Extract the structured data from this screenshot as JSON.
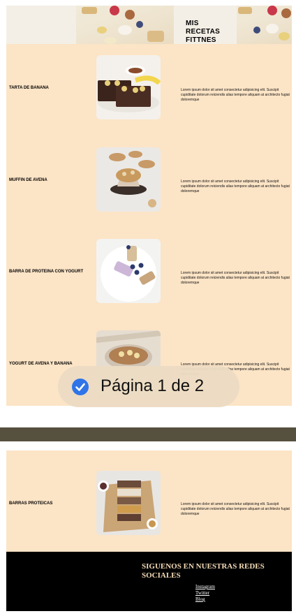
{
  "header": {
    "title_lines": [
      "MIS",
      "RECETAS",
      "FITTNES"
    ]
  },
  "recipes": [
    {
      "name": "TARTA DE BANANA",
      "description": "Lorem ipsum dolor sit amet consectetur adipisicing elit. Suscipit cupiditate dolorum reiciendis alias tempore aliquam at architecto fugiat doloremque",
      "image": "banana-cake-photo"
    },
    {
      "name": "MUFFIN DE AVENA",
      "description": "Lorem ipsum dolor sit amet consectetur adipisicing elit. Suscipit cupiditate dolorum reiciendis alias tempore aliquam at architecto fugiat doloremque",
      "image": "oat-muffin-photo"
    },
    {
      "name": "BARRA DE PROTEINA CON YOGURT",
      "description": "Lorem ipsum dolor sit amet consectetur adipisicing elit. Suscipit cupiditate dolorum reiciendis alias tempore aliquam at architecto fugiat doloremque",
      "image": "yogurt-protein-bar-photo"
    },
    {
      "name": "YOGURT DE AVENA Y BANANA",
      "description": "Lorem ipsum dolor sit amet consectetur adipisicing elit. Suscipit cupiditate dolorum reiciendis alias tempore aliquam at architecto fugiat doloremque",
      "image": "oat-banana-yogurt-photo"
    },
    {
      "name": "BARRAS PROTEICAS",
      "description": "Lorem ipsum dolor sit amet consectetur adipisicing elit. Suscipit cupiditate dolorum reiciendis alias tempore aliquam at architecto fugiat doloremque",
      "image": "protein-bars-photo"
    }
  ],
  "page_indicator": {
    "text": "Página 1 de 2",
    "icon": "checkmark-circle-icon"
  },
  "footer": {
    "title": "SIGUENOS EN NUESTRAS REDES SOCIALES",
    "links": [
      "Instagram",
      "Twitter",
      "Blog"
    ]
  },
  "colors": {
    "page_background": "#fce4c6",
    "footer_background": "#000000",
    "footer_title": "#f5dcb8",
    "accent_blue": "#2f74e8",
    "divider": "#56503f"
  }
}
